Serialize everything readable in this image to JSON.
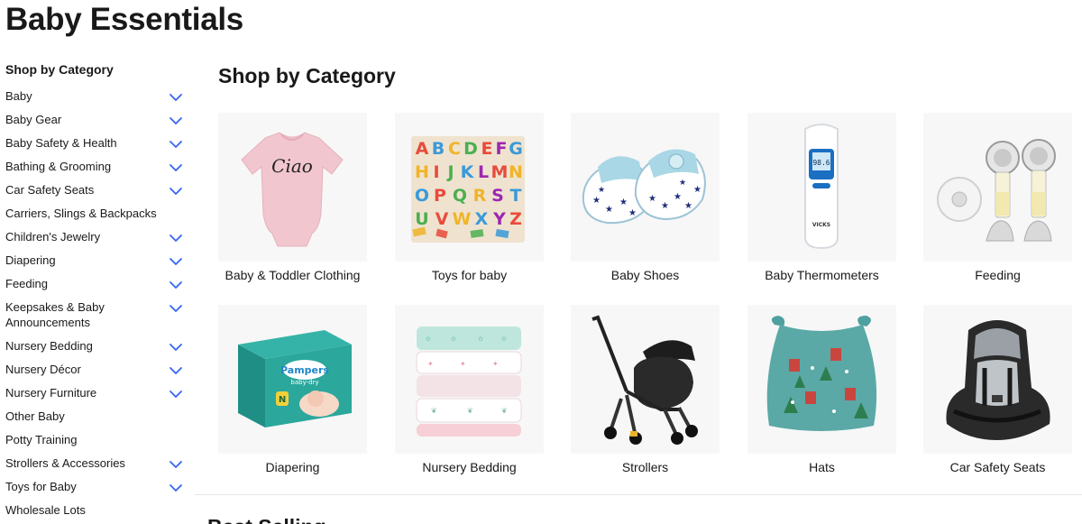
{
  "page": {
    "title": "Baby Essentials"
  },
  "sidebar": {
    "heading": "Shop by Category",
    "items": [
      {
        "label": "Baby",
        "expandable": true
      },
      {
        "label": "Baby Gear",
        "expandable": true
      },
      {
        "label": "Baby Safety & Health",
        "expandable": true
      },
      {
        "label": "Bathing & Grooming",
        "expandable": true
      },
      {
        "label": "Car Safety Seats",
        "expandable": true
      },
      {
        "label": "Carriers, Slings & Backpacks",
        "expandable": false
      },
      {
        "label": "Children's Jewelry",
        "expandable": true
      },
      {
        "label": "Diapering",
        "expandable": true
      },
      {
        "label": "Feeding",
        "expandable": true
      },
      {
        "label": "Keepsakes & Baby Announcements",
        "expandable": true
      },
      {
        "label": "Nursery Bedding",
        "expandable": true
      },
      {
        "label": "Nursery Décor",
        "expandable": true
      },
      {
        "label": "Nursery Furniture",
        "expandable": true
      },
      {
        "label": "Other Baby",
        "expandable": false
      },
      {
        "label": "Potty Training",
        "expandable": false
      },
      {
        "label": "Strollers & Accessories",
        "expandable": true
      },
      {
        "label": "Toys for Baby",
        "expandable": true
      },
      {
        "label": "Wholesale Lots",
        "expandable": false
      }
    ]
  },
  "main": {
    "section_title": "Shop by Category",
    "tiles": [
      {
        "caption": "Baby & Toddler Clothing",
        "icon": "onesie-image",
        "onesie_text": "Ciao"
      },
      {
        "caption": "Toys for baby",
        "icon": "alphabet-puzzle-image"
      },
      {
        "caption": "Baby Shoes",
        "icon": "baby-shoes-image"
      },
      {
        "caption": "Baby Thermometers",
        "icon": "thermometer-image",
        "reading": "98.6",
        "brand": "VICKS"
      },
      {
        "caption": "Feeding",
        "icon": "breast-pump-image"
      },
      {
        "caption": "Diapering",
        "icon": "diaper-box-image",
        "brand": "Pampers",
        "sub": "baby-dry",
        "size": "N"
      },
      {
        "caption": "Nursery Bedding",
        "icon": "swaddle-blankets-image"
      },
      {
        "caption": "Strollers",
        "icon": "stroller-image"
      },
      {
        "caption": "Hats",
        "icon": "baby-hat-image"
      },
      {
        "caption": "Car Safety Seats",
        "icon": "car-seat-image"
      }
    ],
    "next_section_title": "Best Selling"
  },
  "colors": {
    "chevron": "#3665f3",
    "tile_bg": "#f7f7f7",
    "text": "#191919"
  }
}
